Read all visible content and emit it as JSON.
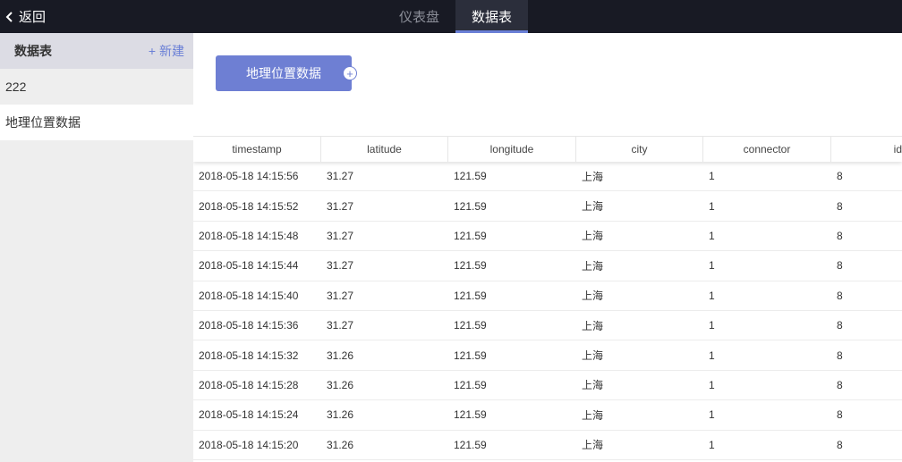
{
  "topbar": {
    "back_label": "返回",
    "tabs": [
      {
        "label": "仪表盘",
        "active": false
      },
      {
        "label": "数据表",
        "active": true
      }
    ]
  },
  "sidebar": {
    "title": "数据表",
    "new_label": "+ 新建",
    "items": [
      {
        "label": "222"
      },
      {
        "label": "地理位置数据"
      }
    ]
  },
  "main": {
    "dataset_button": "地理位置数据",
    "add_icon_glyph": "+",
    "columns": [
      "timestamp",
      "latitude",
      "longitude",
      "city",
      "connector",
      "id"
    ],
    "rows": [
      [
        "2018-05-18 14:15:56",
        "31.27",
        "121.59",
        "上海",
        "1",
        "8"
      ],
      [
        "2018-05-18 14:15:52",
        "31.27",
        "121.59",
        "上海",
        "1",
        "8"
      ],
      [
        "2018-05-18 14:15:48",
        "31.27",
        "121.59",
        "上海",
        "1",
        "8"
      ],
      [
        "2018-05-18 14:15:44",
        "31.27",
        "121.59",
        "上海",
        "1",
        "8"
      ],
      [
        "2018-05-18 14:15:40",
        "31.27",
        "121.59",
        "上海",
        "1",
        "8"
      ],
      [
        "2018-05-18 14:15:36",
        "31.27",
        "121.59",
        "上海",
        "1",
        "8"
      ],
      [
        "2018-05-18 14:15:32",
        "31.26",
        "121.59",
        "上海",
        "1",
        "8"
      ],
      [
        "2018-05-18 14:15:28",
        "31.26",
        "121.59",
        "上海",
        "1",
        "8"
      ],
      [
        "2018-05-18 14:15:24",
        "31.26",
        "121.59",
        "上海",
        "1",
        "8"
      ],
      [
        "2018-05-18 14:15:20",
        "31.26",
        "121.59",
        "上海",
        "1",
        "8"
      ]
    ]
  },
  "colors": {
    "topbar_bg": "#181a24",
    "accent": "#6e7fd3",
    "sidebar_bg": "#eeeeee"
  }
}
